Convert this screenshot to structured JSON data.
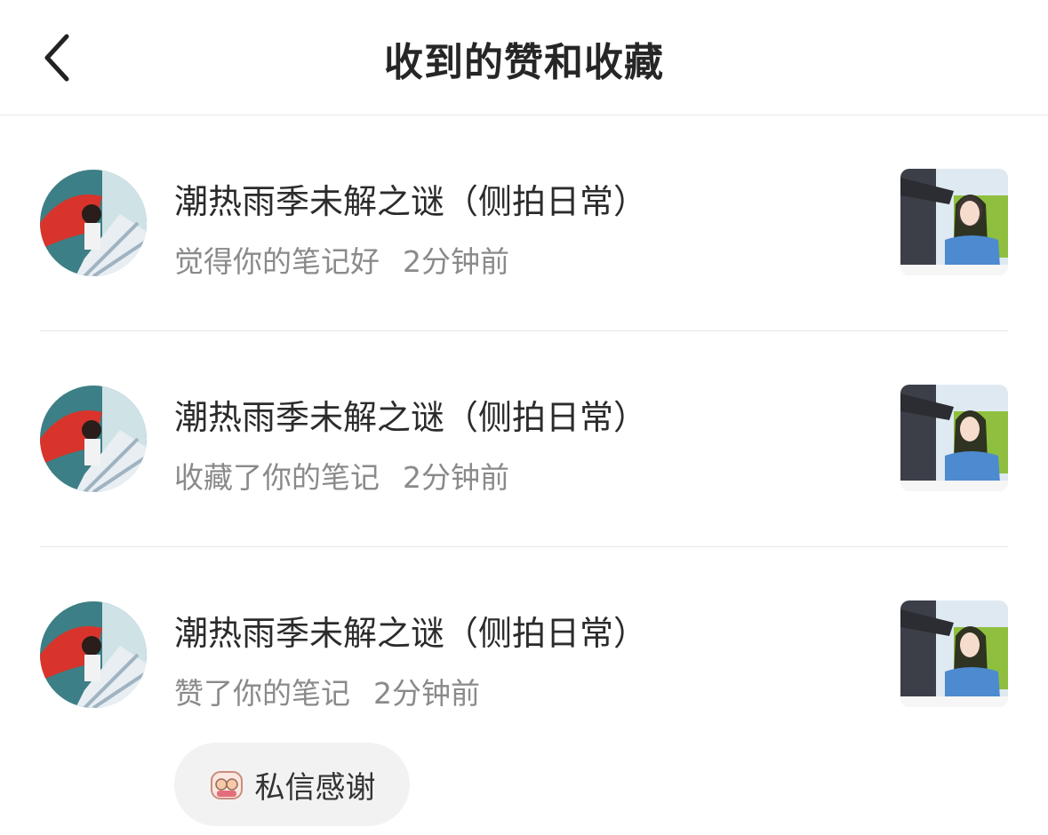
{
  "header": {
    "title": "收到的赞和收藏",
    "back_icon": "chevron-left-icon"
  },
  "notifications": [
    {
      "user_name": "潮热雨季未解之谜（侧拍日常）",
      "action": "觉得你的笔记好",
      "time": "2分钟前"
    },
    {
      "user_name": "潮热雨季未解之谜（侧拍日常）",
      "action": "收藏了你的笔记",
      "time": "2分钟前"
    },
    {
      "user_name": "潮热雨季未解之谜（侧拍日常）",
      "action": "赞了你的笔记",
      "time": "2分钟前"
    }
  ],
  "thank_button": {
    "label": "私信感谢",
    "icon": "sticker-emoji-icon"
  },
  "colors": {
    "title_text": "#262626",
    "name_text": "#2b2b2b",
    "meta_text": "#8a8a8a",
    "divider": "#e6e6e6",
    "button_bg": "#f2f2f2"
  }
}
